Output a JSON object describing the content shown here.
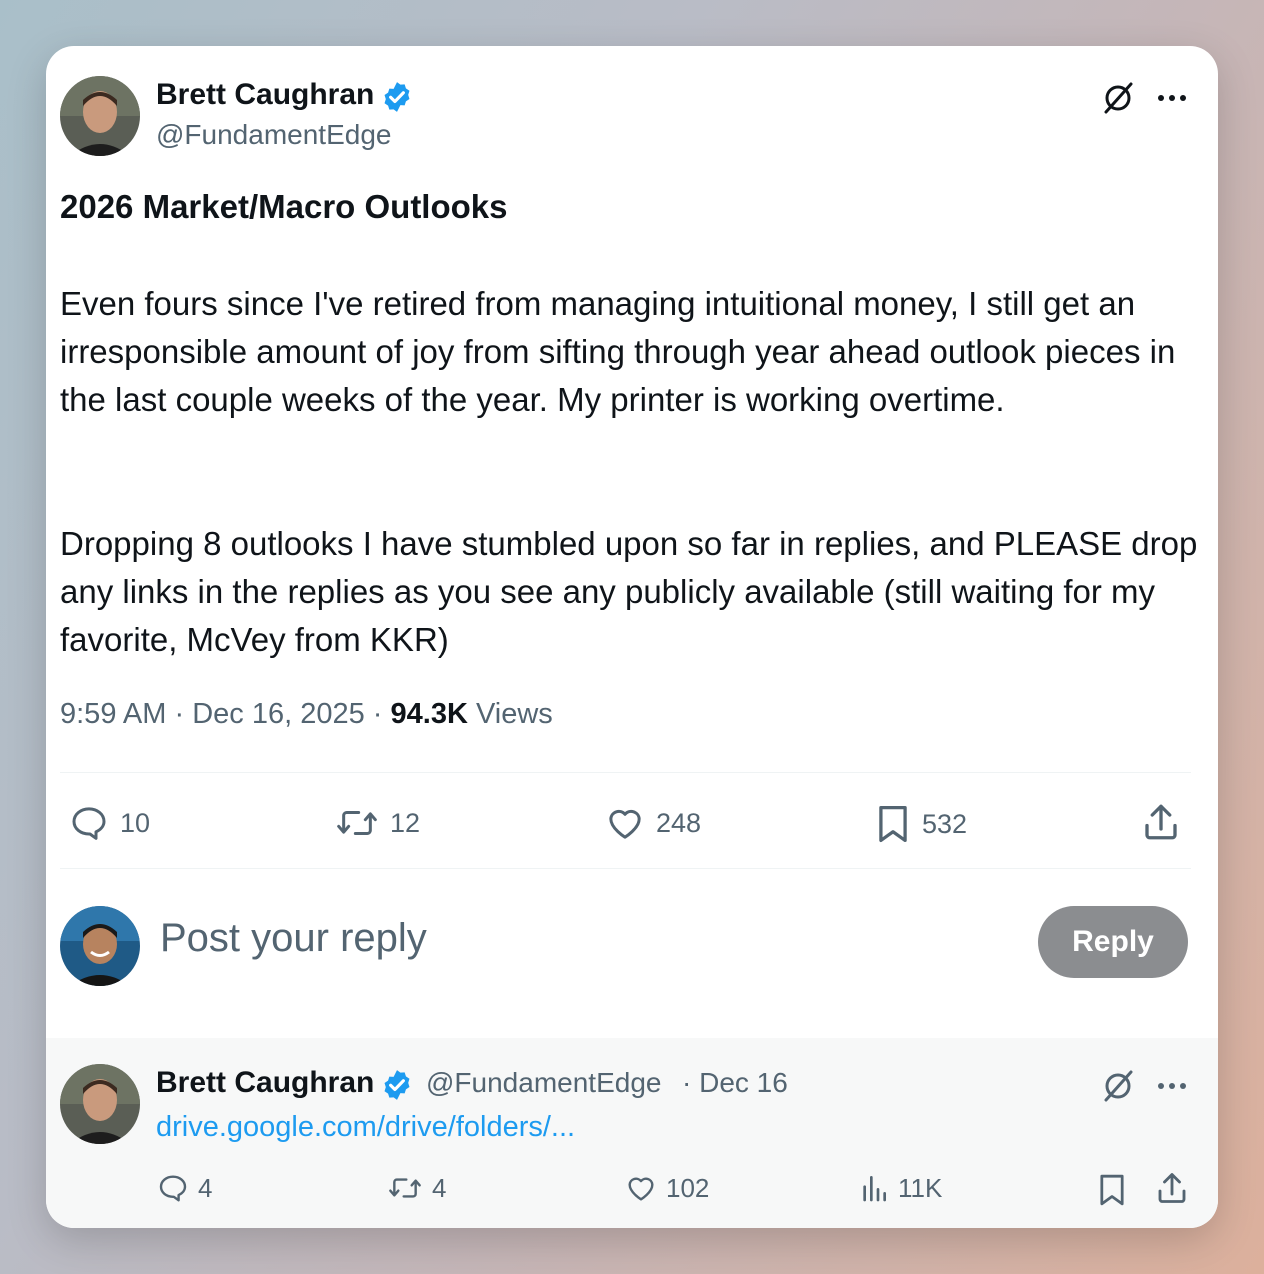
{
  "tweet": {
    "author_name": "Brett Caughran",
    "author_handle": "@FundamentEdge",
    "title": "2026 Market/Macro Outlooks",
    "paragraph1": "Even fours since I've retired from managing intuitional money, I still get an irresponsible amount of joy from sifting through year ahead outlook pieces in the last couple weeks of the year. My printer is working overtime.",
    "paragraph2": "Dropping 8 outlooks I have stumbled upon so far in replies, and PLEASE drop any links in the replies as you see any publicly available (still waiting for my favorite, McVey from KKR)",
    "time": "9:59 AM",
    "date": "Dec 16, 2025",
    "views_count": "94.3K",
    "views_label": "Views",
    "separator": "·",
    "stats": {
      "replies": "10",
      "reposts": "12",
      "likes": "248",
      "bookmarks": "532"
    }
  },
  "composer": {
    "placeholder": "Post your reply",
    "button_label": "Reply"
  },
  "reply": {
    "author_name": "Brett Caughran",
    "author_handle": "@FundamentEdge",
    "date": "· Dec 16",
    "link_text": "drive.google.com/drive/folders/...",
    "stats": {
      "replies": "4",
      "reposts": "4",
      "likes": "102",
      "views": "11K"
    }
  },
  "icons": {
    "verified": "verified-badge-icon",
    "grok": "grok-slash-circle-icon",
    "more": "more-horizontal-icon",
    "reply": "reply-bubble-icon",
    "repost": "repost-icon",
    "like": "heart-icon",
    "bookmark": "bookmark-icon",
    "share": "share-upload-icon",
    "views": "analytics-bars-icon"
  },
  "colors": {
    "verified_blue": "#1d9bf0",
    "link_blue": "#1d9bf0",
    "muted_text": "#536471",
    "reply_button": "#8b8d90"
  }
}
